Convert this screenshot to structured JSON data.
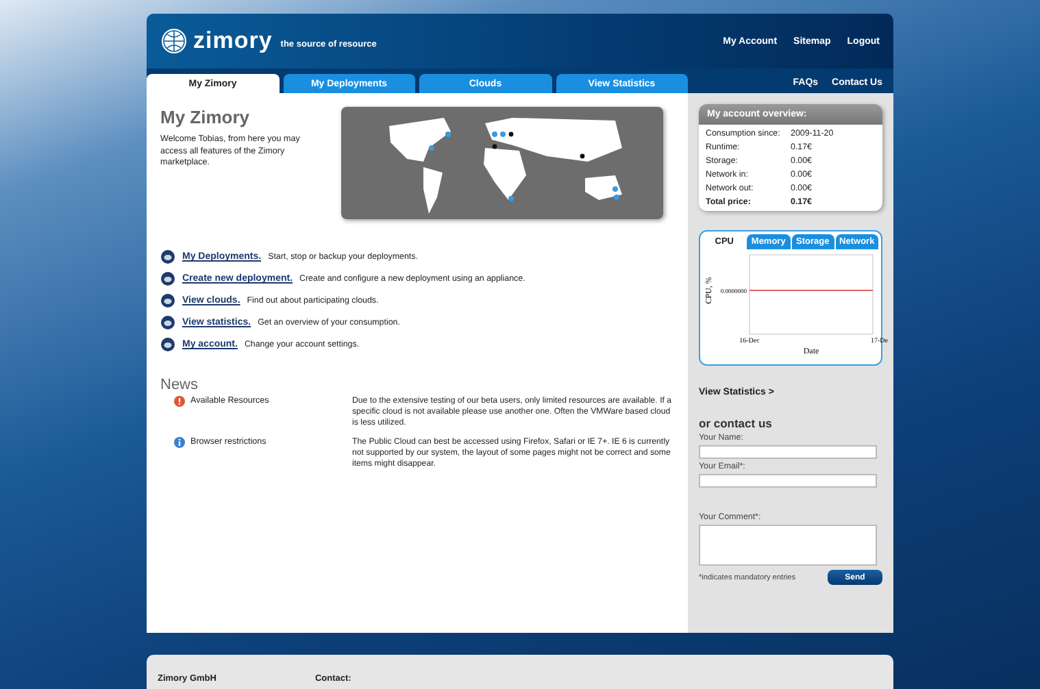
{
  "header": {
    "logo": "zimory",
    "tagline": "the source of resource",
    "links": [
      "My Account",
      "Sitemap",
      "Logout"
    ]
  },
  "tabs": [
    {
      "label": "My Zimory",
      "selected": true
    },
    {
      "label": "My Deployments",
      "selected": false
    },
    {
      "label": "Clouds",
      "selected": false
    },
    {
      "label": "View Statistics",
      "selected": false
    }
  ],
  "top_links": [
    "FAQs",
    "Contact Us"
  ],
  "main": {
    "title": "My Zimory",
    "welcome": "Welcome Tobias, from here you may access all features of the Zimory marketplace.",
    "shortcuts": [
      {
        "link": "My Deployments.",
        "text": "Start, stop or backup your deployments."
      },
      {
        "link": "Create new deployment.",
        "text": "Create and configure a new deployment using an appliance."
      },
      {
        "link": "View clouds.",
        "text": "Find out about participating clouds."
      },
      {
        "link": "View statistics.",
        "text": "Get an overview of your consumption."
      },
      {
        "link": "My account.",
        "text": "Change your account settings."
      }
    ]
  },
  "news": {
    "title": "News",
    "items": [
      {
        "kind": "warning",
        "title": "Available Resources",
        "text": "Due to the extensive testing of our beta users, only limited resources are available. If a specific cloud is not available please use another one. Often the VMWare based cloud is less utilized."
      },
      {
        "kind": "info",
        "title": "Browser restrictions",
        "text": "The Public Cloud can best be accessed using Firefox, Safari or IE 7+. IE 6 is currently not supported by our system, the layout of some pages might not be correct and some items might disappear."
      }
    ]
  },
  "overview": {
    "title": "My account overview:",
    "rows": [
      {
        "label": "Consumption since:",
        "value": "2009-11-20",
        "total": false
      },
      {
        "label": "Runtime:",
        "value": "0.17€",
        "total": false
      },
      {
        "label": "Storage:",
        "value": "0.00€",
        "total": false
      },
      {
        "label": "Network in:",
        "value": "0.00€",
        "total": false
      },
      {
        "label": "Network out:",
        "value": "0.00€",
        "total": false
      },
      {
        "label": "Total price:",
        "value": "0.17€",
        "total": true
      }
    ]
  },
  "stats": {
    "tabs": [
      {
        "label": "CPU",
        "selected": true
      },
      {
        "label": "Memory",
        "selected": false
      },
      {
        "label": "Storage",
        "selected": false
      },
      {
        "label": "Network",
        "selected": false
      }
    ],
    "chart": {
      "xlabel": "Date",
      "ylabel": "CPU, %",
      "x_labels": [
        "16-Dec",
        "17-De"
      ],
      "y_label_tick": "0.0000000"
    },
    "link": "View Statistics >"
  },
  "contact": {
    "title": "or contact us",
    "fields": [
      {
        "label": "Your Name:",
        "kind": "line"
      },
      {
        "label": "Your Email*:",
        "kind": "line"
      },
      {
        "label": "Your Comment*:",
        "kind": "area"
      }
    ],
    "note": "*indicates mandatory entries",
    "button": "Send"
  },
  "footer": {
    "company": "Zimory GmbH",
    "contact": "Contact:"
  }
}
